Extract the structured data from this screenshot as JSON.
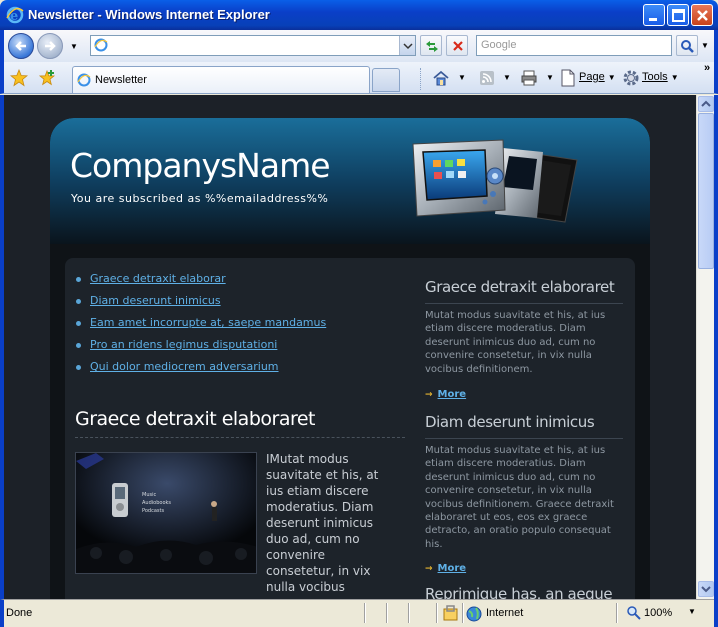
{
  "window": {
    "title": "Newsletter - Windows Internet Explorer"
  },
  "address_bar": {
    "url": "",
    "search_placeholder": "Google"
  },
  "tabs": [
    {
      "label": "Newsletter",
      "active": true
    }
  ],
  "commands": {
    "page": "Page",
    "tools": "Tools"
  },
  "newsletter": {
    "brand": "CompanysName",
    "subscribed": "You are subscribed as %%emailaddress%%",
    "links": [
      "Graece detraxit elaborar",
      "Diam deserunt inimicus",
      "Eam amet incorrupte at, saepe mandamus",
      "Pro an ridens legimus disputationi",
      "Qui dolor mediocrem adversarium"
    ],
    "main_article": {
      "heading": "Graece detraxit elaboraret",
      "body": "IMutat modus suavitate et his, at ius etiam discere moderatius. Diam deserunt inimicus duo ad, cum no convenire consetetur, in vix nulla vocibus",
      "photo_caption": [
        "Music",
        "Audiobooks",
        "Podcasts"
      ]
    },
    "sidebar": [
      {
        "heading": "Graece detraxit elaboraret",
        "body": "Mutat modus suavitate et his, at ius etiam discere moderatius. Diam deserunt inimicus duo ad, cum no convenire consetetur, in vix nulla vocibus definitionem.",
        "more": "More"
      },
      {
        "heading": "Diam deserunt inimicus",
        "body": "Mutat modus suavitate et his, at ius etiam discere moderatius. Diam deserunt inimicus duo ad, cum no convenire consetetur, in vix nulla vocibus definitionem. Graece detraxit elaboraret ut eos, eos ex graece detracto, an oratio populo consequat his.",
        "more": "More"
      },
      {
        "heading": "Reprimique has, an aeque",
        "body": "",
        "more": ""
      }
    ]
  },
  "status": {
    "text": "Done",
    "zone": "Internet",
    "zoom": "100%"
  },
  "colors": {
    "title_bar": "#0a3fc8",
    "page_bg": "#1c2128",
    "link": "#5fb0e6",
    "accent_arrow": "#e0b030"
  }
}
